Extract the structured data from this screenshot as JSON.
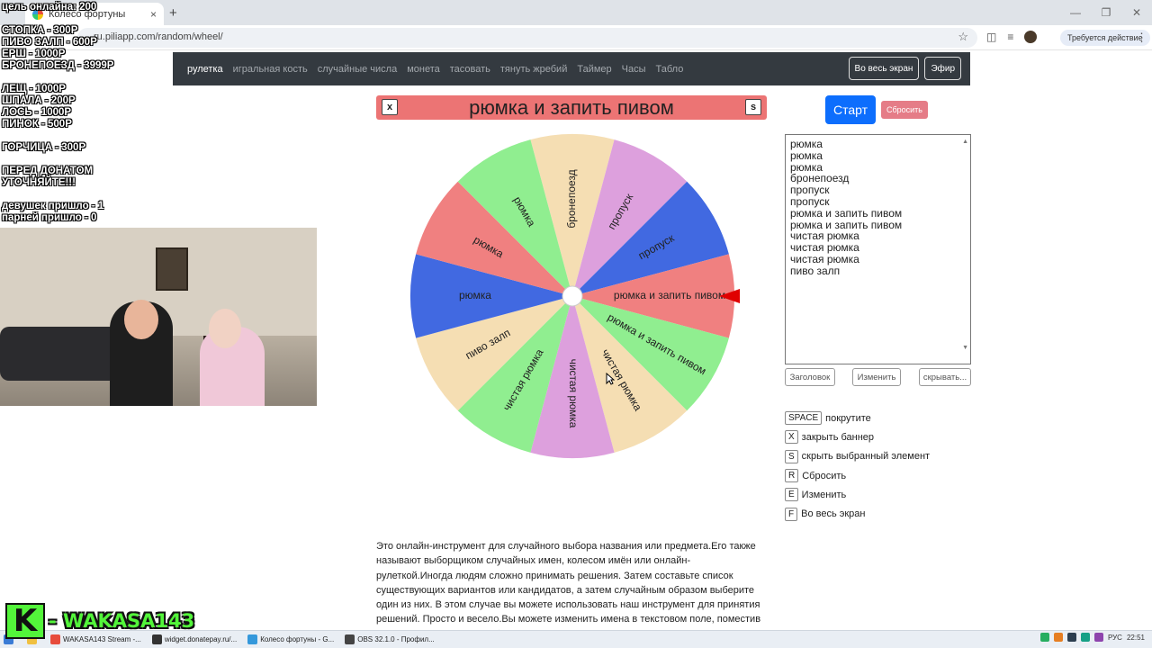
{
  "browser": {
    "tab_title": "Колесо фортуны",
    "url": "ru.piliapp.com/random/wheel/",
    "action_button": "Требуется действие",
    "new_tab": "+",
    "tab_close": "×"
  },
  "overlay": {
    "lines": [
      "цель онлайна: 200",
      "",
      "СТОПКА - 300Р",
      "ПИВО ЗАЛП - 600Р",
      "ЕРШ - 1000Р",
      "БРОНЕПОЕЗД - 3999Р",
      "",
      "ЛЕЩ - 1000Р",
      "ШПАЛА - 200Р",
      "ЛОСЬ - 1000Р",
      "ПИНОК - 500Р",
      "",
      "ГОРЧИЦА - 300Р",
      "",
      "ПЕРЕД ДОНАТОМ",
      "УТОЧНЯЙТЕ!!!",
      "",
      "девушек пришло - 1",
      "парней пришло - 0"
    ],
    "brand_letter": "K",
    "brand_name": "- WAKASA143"
  },
  "nav": {
    "items": [
      "рулетка",
      "игральная кость",
      "случайные числа",
      "монета",
      "тасовать",
      "тянуть жребий",
      "Таймер",
      "Часы",
      "Табло"
    ],
    "fullscreen": "Во весь экран",
    "broadcast": "Эфир"
  },
  "banner": {
    "text": "рюмка и запить пивом",
    "close_key": "x",
    "hide_key": "s",
    "color": "#ec7474"
  },
  "wheel": {
    "segments": [
      {
        "label": "бронепоезд",
        "color": "#f5deb3"
      },
      {
        "label": "пропуск",
        "color": "#dda0dd"
      },
      {
        "label": "пропуск",
        "color": "#4169e1"
      },
      {
        "label": "рюмка и запить пивом",
        "color": "#f08080"
      },
      {
        "label": "рюмка и запить пивом",
        "color": "#90ee90"
      },
      {
        "label": "чистая рюмка",
        "color": "#f5deb3"
      },
      {
        "label": "чистая рюмка",
        "color": "#dda0dd"
      },
      {
        "label": "чистая рюмка",
        "color": "#90ee90"
      },
      {
        "label": "пиво залп",
        "color": "#f5deb3"
      },
      {
        "label": "рюмка",
        "color": "#4169e1"
      },
      {
        "label": "рюмка",
        "color": "#f08080"
      },
      {
        "label": "рюмка",
        "color": "#90ee90"
      }
    ],
    "pointer_color": "#e00000"
  },
  "controls": {
    "start": "Старт",
    "reset": "Сбросить"
  },
  "names_list": [
    "рюмка",
    "рюмка",
    "рюмка",
    "бронепоезд",
    "пропуск",
    "пропуск",
    "рюмка и запить пивом",
    "рюмка и запить пивом",
    "чистая рюмка",
    "чистая рюмка",
    "чистая рюмка",
    "пиво залп"
  ],
  "list_buttons": {
    "title": "Заголовок",
    "edit": "Изменить",
    "hide": "скрывать..."
  },
  "shortcuts": [
    {
      "key": "SPACE",
      "label": "покрутите"
    },
    {
      "key": "X",
      "label": "закрыть баннер"
    },
    {
      "key": "S",
      "label": "скрыть выбранный элемент"
    },
    {
      "key": "R",
      "label": "Сбросить"
    },
    {
      "key": "E",
      "label": "Изменить"
    },
    {
      "key": "F",
      "label": "Во весь экран"
    }
  ],
  "description": "Это онлайн-инструмент для случайного выбора названия или предмета.Его также называют выборщиком случайных имен, колесом имён или онлайн-рулеткой.Иногда людям сложно принимать решения. Затем составьте список существующих вариантов или кандидатов, а затем случайным образом выберите один из них. В этом случае вы можете использовать наш инструмент для принятия решений. Просто и весело.Вы можете изменить имена в текстовом поле, поместив одно имя в строку.Имена будут",
  "taskbar": {
    "items": [
      {
        "label": "WAKASA143 Stream -...",
        "color": "#e74c3c"
      },
      {
        "label": "widget.donatepay.ru/...",
        "color": "#333"
      },
      {
        "label": "Колесо фортуны - G...",
        "color": "#3498db"
      },
      {
        "label": "OBS 32.1.0 - Профил...",
        "color": "#444"
      }
    ],
    "lang": "РУС",
    "time": "22:51"
  }
}
